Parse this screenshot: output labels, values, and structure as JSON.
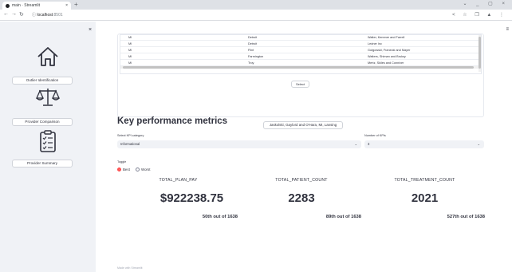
{
  "browser": {
    "tab_title": "main · Streamlit",
    "tab_close": "×",
    "new_tab": "+",
    "url_host": "localhost",
    "url_port": ":8501",
    "window_controls": "⌄ _ ▢ ×",
    "toolbar_icons": "< ☆ ❐ ▲ ⋮"
  },
  "sidebar": {
    "close_label": "×",
    "buttons": [
      {
        "label": "Outlier Identification"
      },
      {
        "label": "Provider Comparison"
      },
      {
        "label": "Provider Summary"
      }
    ],
    "icons": [
      "home-icon",
      "scales-icon",
      "clipboard-icon"
    ]
  },
  "table": {
    "rows": [
      {
        "state": "MI",
        "city": "Detroit",
        "provider": "Walter, Kemmer and Farrell"
      },
      {
        "state": "MI",
        "city": "Detroit",
        "provider": "Ledner Inc"
      },
      {
        "state": "MI",
        "city": "Flint",
        "provider": "Gutgowski, Franecki and Mayer"
      },
      {
        "state": "MI",
        "city": "Farmington",
        "provider": "Walters, Shiman and Bruksy"
      },
      {
        "state": "MI",
        "city": "Troy",
        "provider": "Mertz, Skiles and Conniver"
      }
    ]
  },
  "select_button": "Select",
  "provider_button": "Jaskolski, Gaylord and O'Hara, MI, Lansing",
  "kpi_section": {
    "title": "Key performance metrics",
    "category_label": "Select KPI category",
    "category_value": "Informational",
    "count_label": "Number of KPIs",
    "count_value": "3",
    "caret": "⌄",
    "toggle_label": "Toggle",
    "toggle_best": "Best",
    "toggle_worst": "Worst"
  },
  "kpis": [
    {
      "name": "TOTAL_PLAN_PAY",
      "value": "$922238.75",
      "rank": "50th out of 1638"
    },
    {
      "name": "TOTAL_PATIENT_COUNT",
      "value": "2283",
      "rank": "89th out of 1638"
    },
    {
      "name": "TOTAL_TREATMENT_COUNT",
      "value": "2021",
      "rank": "527th out of 1638"
    }
  ],
  "footer": "Made with Streamlit",
  "menu_icon": "≡",
  "colors": {
    "accent": "#ff4b4b",
    "sidebar_bg": "#f0f2f6",
    "text": "#31333f"
  }
}
